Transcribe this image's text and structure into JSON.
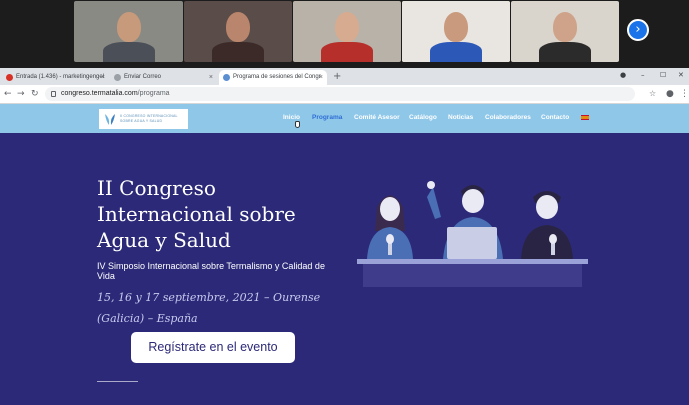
{
  "call": {
    "participants": [
      {
        "name": "participant-1",
        "bg": "#8a8a84",
        "skin": "#c89a7c",
        "clothing": "#4b5058"
      },
      {
        "name": "participant-2",
        "bg": "#5a4c48",
        "skin": "#b9856c",
        "clothing": "#3b2a28"
      },
      {
        "name": "participant-3",
        "bg": "#b8b2a8",
        "skin": "#d7ab8f",
        "clothing": "#b62f2b"
      },
      {
        "name": "participant-4",
        "bg": "#e9e6e1",
        "skin": "#c99a7d",
        "clothing": "#2c58b7"
      },
      {
        "name": "participant-5",
        "bg": "#d9d4cc",
        "skin": "#cfa389",
        "clothing": "#2b2b2b"
      }
    ],
    "next_glyph": "›"
  },
  "browser": {
    "tabs": [
      {
        "title": "Entrada (1.436) - marketingengel",
        "favicon_color": "#d93025"
      },
      {
        "title": "Enviar Correo",
        "favicon_color": "#9aa0a6"
      },
      {
        "title": "Programa de sesiones del Congr",
        "favicon_color": "#5b8fd1"
      }
    ],
    "tab_close": "×",
    "new_tab": "+",
    "url_host": "congreso.termatalia.com",
    "url_path": "/programa",
    "back": "←",
    "forward": "→",
    "reload": "↻",
    "minimize": "–",
    "maximize": "☐",
    "close": "✕"
  },
  "site": {
    "logo_lines": [
      "II CONGRESO INTERNACIONAL",
      "SOBRE AGUA Y SALUD"
    ],
    "menu": [
      {
        "label": "Inicio",
        "active": false
      },
      {
        "label": "Programa",
        "active": true
      },
      {
        "label": "Comité Asesor",
        "active": false
      },
      {
        "label": "Catálogo",
        "active": false
      },
      {
        "label": "Noticias",
        "active": false
      },
      {
        "label": "Colaboradores",
        "active": false
      },
      {
        "label": "Contacto",
        "active": false
      }
    ],
    "hero": {
      "title_lines": [
        "II Congreso",
        "Internacional sobre",
        "Agua y Salud"
      ],
      "subtitle": "IV Simposio Internacional sobre Termalismo y Calidad de Vida",
      "date": "15, 16 y 17 septiembre, 2021 – Ourense (Galicia) – España",
      "cta": "Regístrate en el evento"
    },
    "colors": {
      "hero_bg": "#2c2a78",
      "nav_bg": "#8fc7e8",
      "menu_active": "#2f6fd6"
    }
  }
}
